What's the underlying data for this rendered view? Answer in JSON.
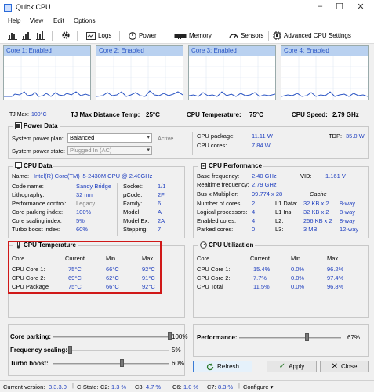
{
  "window": {
    "title": "Quick CPU",
    "minimize": "–",
    "maximize": "☐",
    "close": "✕"
  },
  "menu": [
    "Help",
    "View",
    "Edit",
    "Options"
  ],
  "toolbar": {
    "logs": "Logs",
    "power": "Power",
    "memory": "Memory",
    "sensors": "Sensors",
    "advanced": "Advanced CPU Settings"
  },
  "cores": [
    {
      "label": "Core 1: Enabled"
    },
    {
      "label": "Core 2: Enabled"
    },
    {
      "label": "Core 3: Enabled"
    },
    {
      "label": "Core 4: Enabled"
    }
  ],
  "tjline": {
    "tjmax_label": "TJ Max:",
    "tjmax_value": "100°C",
    "tjdist_label": "TJ Max Distance Temp:",
    "tjdist_value": "25°C",
    "cputemp_label": "CPU Temperature:",
    "cputemp_value": "75°C",
    "cpuspeed_label": "CPU Speed:",
    "cpuspeed_value": "2.79 GHz"
  },
  "power_data": {
    "title": "Power Data",
    "plan_label": "System power plan:",
    "plan_value": "Balanced",
    "plan_status": "Active",
    "state_label": "System power state:",
    "state_value": "Plugged In (AC)",
    "pkg_label": "CPU package:",
    "pkg_value": "11.11 W",
    "tdp_label": "TDP:",
    "tdp_value": "35.0 W",
    "cores_label": "CPU cores:",
    "cores_value": "7.84 W"
  },
  "cpu_data": {
    "title": "CPU Data",
    "name_label": "Name:",
    "name_value": "Intel(R) Core(TM) i5-2430M CPU @ 2.40GHz",
    "rows": [
      {
        "l": "Code name:",
        "v": "Sandy Bridge",
        "l2": "Socket:",
        "v2": "1/1"
      },
      {
        "l": "Lithography:",
        "v": "32 nm",
        "l2": "µCode:",
        "v2": "2F"
      },
      {
        "l": "Performance control:",
        "v": "Legacy",
        "l2": "Family:",
        "v2": "6"
      },
      {
        "l": "Core parking index:",
        "v": "100%",
        "l2": "Model:",
        "v2": "A"
      },
      {
        "l": "Core scaling index:",
        "v": "5%",
        "l2": "Model Ex:",
        "v2": "2A"
      },
      {
        "l": "Turbo boost index:",
        "v": "60%",
        "l2": "Stepping:",
        "v2": "7"
      }
    ]
  },
  "cpu_perf": {
    "title": "CPU Performance",
    "base_label": "Base frequency:",
    "base_value": "2.40 GHz",
    "vid_label": "VID:",
    "vid_value": "1.161 V",
    "rt_label": "Realtime frequency:",
    "rt_value": "2.79 GHz",
    "bus_label": "Bus x Multiplier:",
    "bus_value": "99.774 x 28",
    "cache_label": "Cache",
    "rows": [
      {
        "l": "Number of cores:",
        "v": "2",
        "c": "L1 Data:",
        "s": "32 KB x 2",
        "w": "8-way"
      },
      {
        "l": "Logical processors:",
        "v": "4",
        "c": "L1 Ins:",
        "s": "32 KB x 2",
        "w": "8-way"
      },
      {
        "l": "Enabled cores:",
        "v": "4",
        "c": "L2:",
        "s": "256 KB x 2",
        "w": "8-way"
      },
      {
        "l": "Parked cores:",
        "v": "0",
        "c": "L3:",
        "s": "3 MB",
        "w": "12-way"
      }
    ]
  },
  "cpu_temp": {
    "title": "CPU Temperature",
    "headers": [
      "Core",
      "Current",
      "Min",
      "Max"
    ],
    "rows": [
      [
        "CPU Core 1:",
        "75°C",
        "66°C",
        "92°C"
      ],
      [
        "CPU Core 2:",
        "69°C",
        "62°C",
        "91°C"
      ],
      [
        "CPU Package",
        "75°C",
        "66°C",
        "92°C"
      ]
    ]
  },
  "cpu_util": {
    "title": "CPU Utilization",
    "headers": [
      "Core",
      "Current",
      "Min",
      "Max"
    ],
    "rows": [
      [
        "CPU Core 1:",
        "15.4%",
        "0.0%",
        "96.2%"
      ],
      [
        "CPU Core 2:",
        "7.7%",
        "0.0%",
        "97.4%"
      ],
      [
        "CPU Total",
        "11.5%",
        "0.0%",
        "96.8%"
      ]
    ]
  },
  "sliders": {
    "parking_label": "Core parking:",
    "parking_value": "100%",
    "parking_level": 1.0,
    "scaling_label": "Frequency scaling:",
    "scaling_value": "5%",
    "scaling_level": 0.05,
    "turbo_label": "Turbo boost:",
    "turbo_value": "60%",
    "turbo_level": 0.6,
    "perf_label": "Performance:",
    "perf_value": "67%",
    "perf_level": 0.67
  },
  "buttons": {
    "refresh": "Refresh",
    "apply": "Apply",
    "close": "Close"
  },
  "status": {
    "version_label": "Current version:",
    "version_value": "3.3.3.0",
    "cstate_label": "C-State:",
    "c2_label": "C2:",
    "c2_value": "1.3 %",
    "c3_label": "C3:",
    "c3_value": "4.7 %",
    "c6_label": "C6:",
    "c6_value": "1.0 %",
    "c7_label": "C7:",
    "c7_value": "8.3 %",
    "configure": "Configure"
  }
}
